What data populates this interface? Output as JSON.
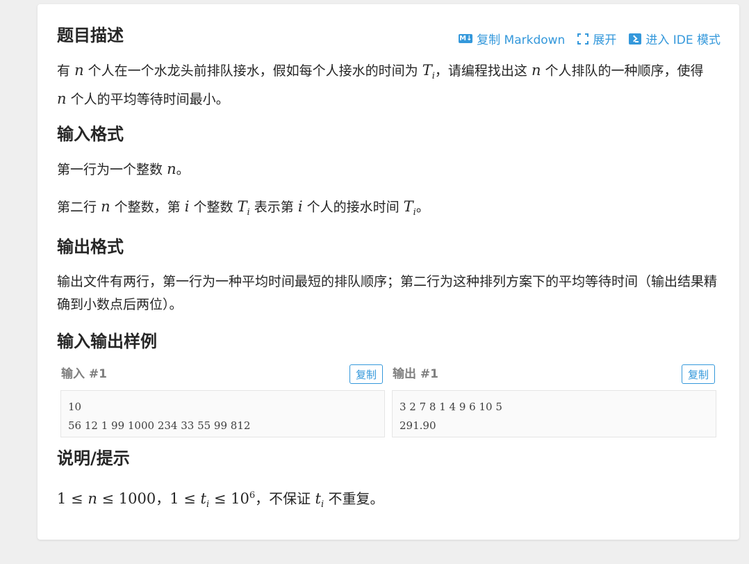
{
  "toolbar": {
    "copy_markdown": "复制 Markdown",
    "expand": "展开",
    "ide_mode": "进入 IDE 模式"
  },
  "sections": {
    "description": {
      "title": "题目描述",
      "p1": "有",
      "n": "n",
      "p2": "个人在一个水龙头前排队接水，假如每个人接水的时间为",
      "T": "T",
      "i": "i",
      "p3": "，请编程找出这",
      "p4": "个人排队的一种顺序，使得",
      "p5": "个人的平均等待时间最小。"
    },
    "input_format": {
      "title": "输入格式",
      "line1_a": "第一行为一个整数",
      "line1_b": "。",
      "line2_a": "第二行",
      "line2_b": "个整数，第",
      "line2_c": "个整数",
      "line2_d": "表示第",
      "line2_e": "个人的接水时间",
      "line2_f": "。"
    },
    "output_format": {
      "title": "输出格式",
      "text": "输出文件有两行，第一行为一种平均时间最短的排队顺序；第二行为这种排列方案下的平均等待时间（输出结果精确到小数点后两位）。"
    },
    "samples": {
      "title": "输入输出样例",
      "input_label": "输入 #1",
      "output_label": "输出 #1",
      "copy_label": "复制",
      "input_text": "10\n56 12 1 99 1000 234 33 55 99 812",
      "output_text": "3 2 7 8 1 4 9 6 10 5\n291.90"
    },
    "hint": {
      "title": "说明/提示",
      "m1": "1 ≤ ",
      "m2": " ≤ 1000",
      "sep": "，",
      "m3": "1 ≤ ",
      "t": "t",
      "m4": " ≤ 10",
      "exp": "6",
      "tail_a": "，不保证",
      "tail_b": "不重复。"
    }
  },
  "colors": {
    "accent": "#3498db",
    "background": "#efefef",
    "card": "#ffffff"
  }
}
